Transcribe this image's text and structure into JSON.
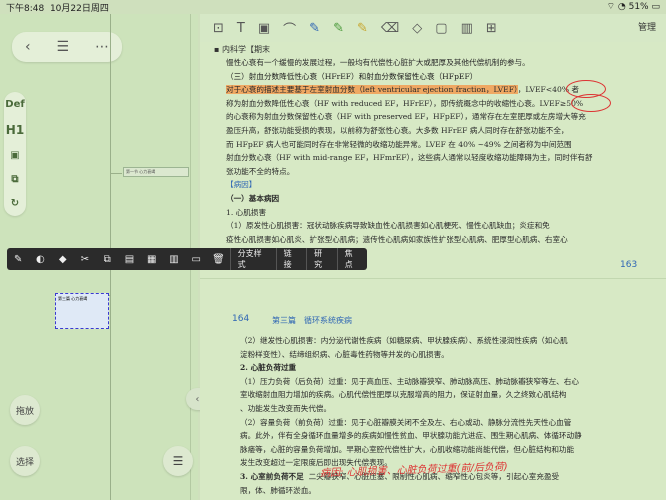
{
  "status": {
    "time": "下午8:48",
    "date": "10月22日周四",
    "battery": "51%"
  },
  "left": {
    "toolbar": [
      "‹",
      "☰",
      "⋯"
    ],
    "tools": [
      "Def",
      "H1",
      "▣",
      "⧉",
      "↻"
    ],
    "node_small": "第一节 心力衰竭",
    "node_selected": "第三篇 心力衰竭",
    "bottom_left_top": "拖放",
    "bottom_left_bottom": "选择"
  },
  "doc": {
    "manage_label": "管理",
    "header_title": "内科学【期末",
    "lines1": [
      "慢性心衰有一个缓慢的发展过程，一般均有代偿性心脏扩大或肥厚及其他代偿机制的参与。",
      "（三）射血分数降低性心衰（HFrEF）和射血分数保留性心衰（HFpEF）"
    ],
    "hl_line": "对于心衰的描述主要基于左室射血分数（left ventricular ejection fraction，LVEF）",
    "hl_tail": "，LVEF<40% 者",
    "lines2": [
      "称为射血分数降低性心衰（HF with reduced EF，HFrEF），即传统概念中的收缩性心衰。LVEF≥50%",
      "的心衰称为射血分数保留性心衰（HF with preserved EF，HFpEF），通常存在左室肥厚或左房增大等充",
      "盈压升高，舒张功能受损的表现，以前称为舒张性心衰。大多数 HFrEF 病人同时存在舒张功能不全，",
      "而 HFpEF 病人也可能同时存在非常轻微的收缩功能异常。LVEF 在 40% ~49% 之间者称为中间范围",
      "射血分数心衰（HF with mid-range EF，HFmrEF），这些病人通常以轻度收缩功能障碍为主，同时伴有舒",
      "张功能不全的特点。"
    ],
    "section_bracket": "【病因】",
    "section_basic": "（一）基本病因",
    "sub1": "1. 心肌损害",
    "lines3": [
      "（1）原发性心肌损害：冠状动脉疾病导致缺血性心肌损害如心肌梗死、慢性心肌缺血；炎症和免",
      "疫性心肌损害如心肌炎、扩张型心肌病；遗传性心肌病如家族性扩张型心肌病、肥厚型心肌病、右室心",
      "肌病、心肌致密化不全、线粒体肌病等。"
    ],
    "page_163": "163",
    "page_164": "164",
    "part_title": "第三篇　循环系统疾病",
    "lines4": [
      "（2）继发性心肌损害：内分泌代谢性疾病（如糖尿病、甲状腺疾病）、系统性浸润性疾病（如心肌",
      "淀粉样变性）、结缔组织病、心脏毒性药物等并发的心肌损害。"
    ],
    "sub2": "2. 心脏负荷过重",
    "lines5": [
      "（1）压力负荷（后负荷）过重：见于高血压、主动脉瓣狭窄、肺动脉高压、肺动脉瓣狭窄等左、右心",
      "室收缩射血阻力增加的疾病。心肌代偿性肥厚以克服增高的阻力，保证射血量，久之终致心肌结构",
      "、功能发生改变而失代偿。",
      "（2）容量负荷（前负荷）过重：见于心脏瓣膜关闭不全及左、右心或动、静脉分流性先天性心血管",
      "病。此外，伴有全身循环血量增多的疾病如慢性贫血、甲状腺功能亢进症、围生期心肌病、体循环动静",
      "脉瘘等，心脏的容量负荷增加。早期心室腔代偿性扩大，心肌收缩功能尚能代偿，但心脏结构和功能",
      "发生改变超过一定限度后即出现失代偿表现。"
    ],
    "sub3": "3. 心室前负荷不足",
    "line6a": "二尖瓣狭窄、心脏压塞、限制性心肌病、缩窄性心包炎等，引起心室充盈受",
    "line6b": "限，体、肺循环淤血。",
    "handwriting": "病因: 心肌损害、心脏负荷过重(前/后负荷)"
  },
  "menu": {
    "icons": [
      "✎",
      "◐",
      "◆",
      "✂",
      "⧉",
      "▤",
      "▦",
      "▥",
      "▭",
      "🗑"
    ],
    "labels": [
      "分支样式",
      "链接",
      "研究",
      "焦点"
    ]
  },
  "colors": {
    "highlight": "#efa863",
    "accent": "#2f66b4",
    "annot": "#d33333"
  }
}
